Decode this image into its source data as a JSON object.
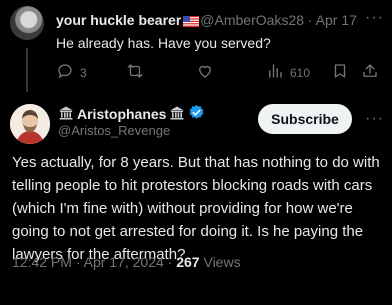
{
  "reply": {
    "name": "your huckle bearer",
    "flag_icon": "us-flag-icon",
    "handle": "@AmberOaks28",
    "separator": "·",
    "date": "Apr 17",
    "text": "He already has. Have you served?",
    "more": "···",
    "actions": {
      "replies": "3",
      "retweets": "",
      "likes": "",
      "views": "610"
    }
  },
  "tweet": {
    "name": "Aristophanes",
    "handle": "@Aristos_Revenge",
    "subscribe_label": "Subscribe",
    "more": "···",
    "body": "Yes actually, for 8 years. But that has nothing to do with telling people to hit protestors blocking roads with cars (which I'm fine with) without providing for how we're going to not get arrested for doing it. Is he paying the lawyers for the aftermath?",
    "time": "12:42 PM",
    "date": "Apr 17, 2024",
    "views_count": "267",
    "views_label": "Views",
    "verified_color": "#1d9bf0"
  }
}
